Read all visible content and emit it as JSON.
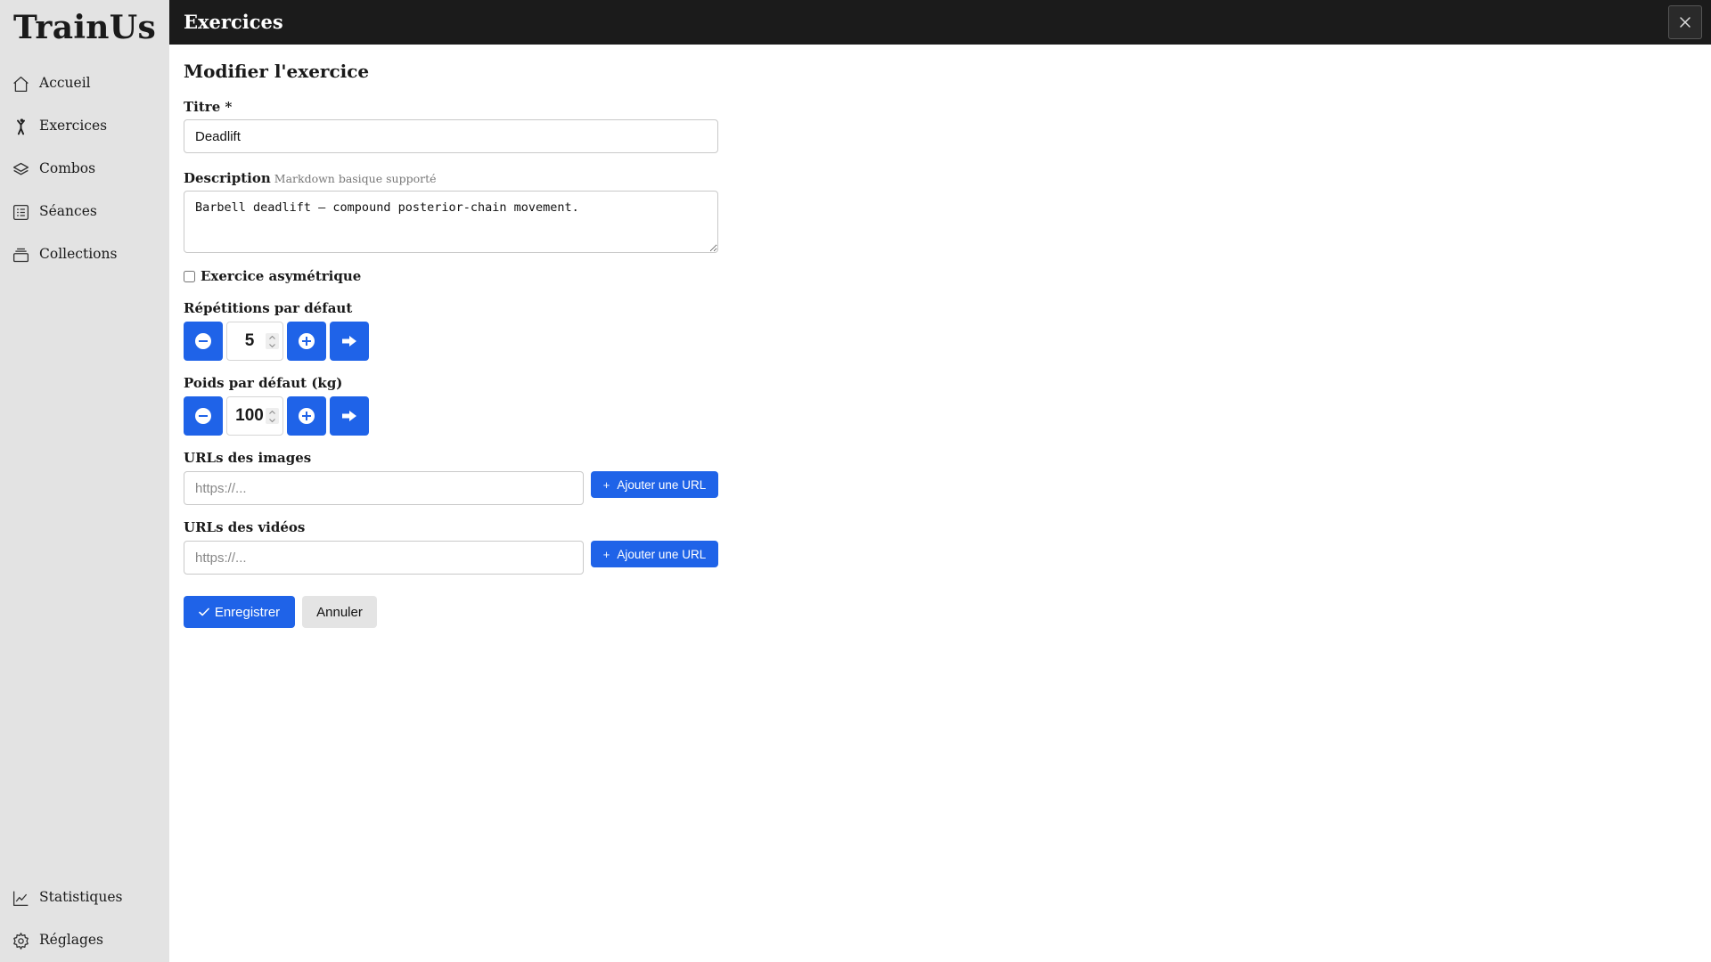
{
  "app": {
    "name": "TrainUs"
  },
  "sidebar": {
    "items": [
      {
        "label": "Accueil",
        "icon": "home-icon"
      },
      {
        "label": "Exercices",
        "icon": "person-exercise-icon"
      },
      {
        "label": "Combos",
        "icon": "layers-icon"
      },
      {
        "label": "Séances",
        "icon": "list-icon"
      },
      {
        "label": "Collections",
        "icon": "stack-icon"
      }
    ],
    "bottom_items": [
      {
        "label": "Statistiques",
        "icon": "chart-line-icon"
      },
      {
        "label": "Réglages",
        "icon": "gear-icon"
      }
    ]
  },
  "header": {
    "title": "Exercices"
  },
  "form": {
    "title": "Modifier l'exercice",
    "titre": {
      "label": "Titre *",
      "value": "Deadlift"
    },
    "description": {
      "label": "Description",
      "hint": "Markdown basique supporté",
      "value": "Barbell deadlift — compound posterior-chain movement."
    },
    "asymmetric": {
      "label": "Exercice asymétrique",
      "checked": false
    },
    "reps": {
      "label": "Répétitions par défaut",
      "value": "5"
    },
    "weight": {
      "label": "Poids par défaut (kg)",
      "value": "100"
    },
    "images": {
      "label": "URLs des images",
      "placeholder": "https://...",
      "add_label": "Ajouter une URL"
    },
    "videos": {
      "label": "URLs des vidéos",
      "placeholder": "https://...",
      "add_label": "Ajouter une URL"
    },
    "save_label": "Enregistrer",
    "cancel_label": "Annuler"
  },
  "colors": {
    "primary": "#1f63e8",
    "sidebar_bg": "#e3e3e3",
    "header_bg": "#1b1b1b"
  }
}
